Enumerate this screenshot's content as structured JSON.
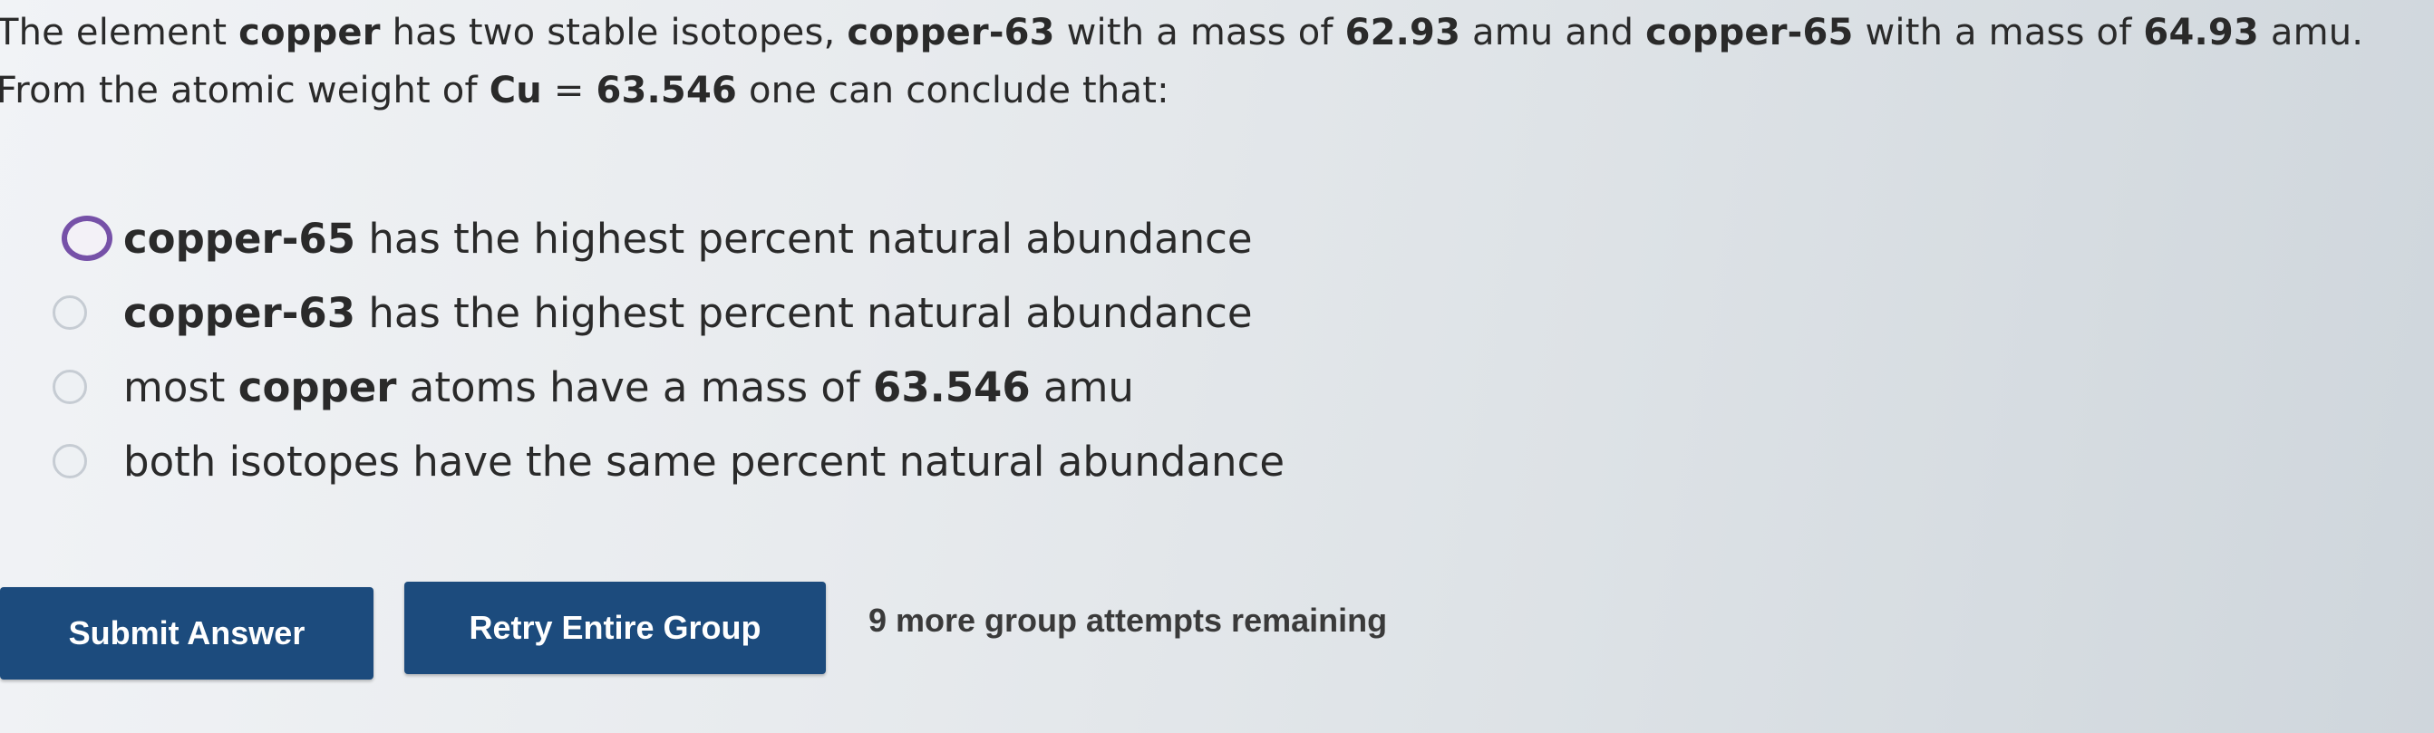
{
  "question": {
    "line1": {
      "t1": "The element ",
      "b1": "copper",
      "t2": " has two stable isotopes, ",
      "b2": "copper-63",
      "t3": " with a mass of ",
      "b3": "62.93",
      "t4": " amu and ",
      "b4": "copper-65",
      "t5": " with a mass of ",
      "b5": "64.93",
      "t6": " amu."
    },
    "line2": {
      "t1": "From the atomic weight of ",
      "b1": "Cu",
      "t2": " = ",
      "b2": "63.546",
      "t3": " one can conclude that:"
    }
  },
  "options": [
    {
      "b": "copper-65",
      "t": " has the highest percent natural abundance"
    },
    {
      "b": "copper-63",
      "t": " has the highest percent natural abundance"
    },
    {
      "t1": "most ",
      "b": "copper",
      "t2": " atoms have a mass of ",
      "b2": "63.546",
      "t3": " amu"
    },
    {
      "t": "both isotopes have the same percent natural abundance"
    }
  ],
  "buttons": {
    "submit": "Submit Answer",
    "retry": "Retry Entire Group"
  },
  "attempts_text": "9 more group attempts remaining",
  "colors": {
    "button_bg": "#1c4b7d",
    "focus_ring": "#7651a8"
  }
}
